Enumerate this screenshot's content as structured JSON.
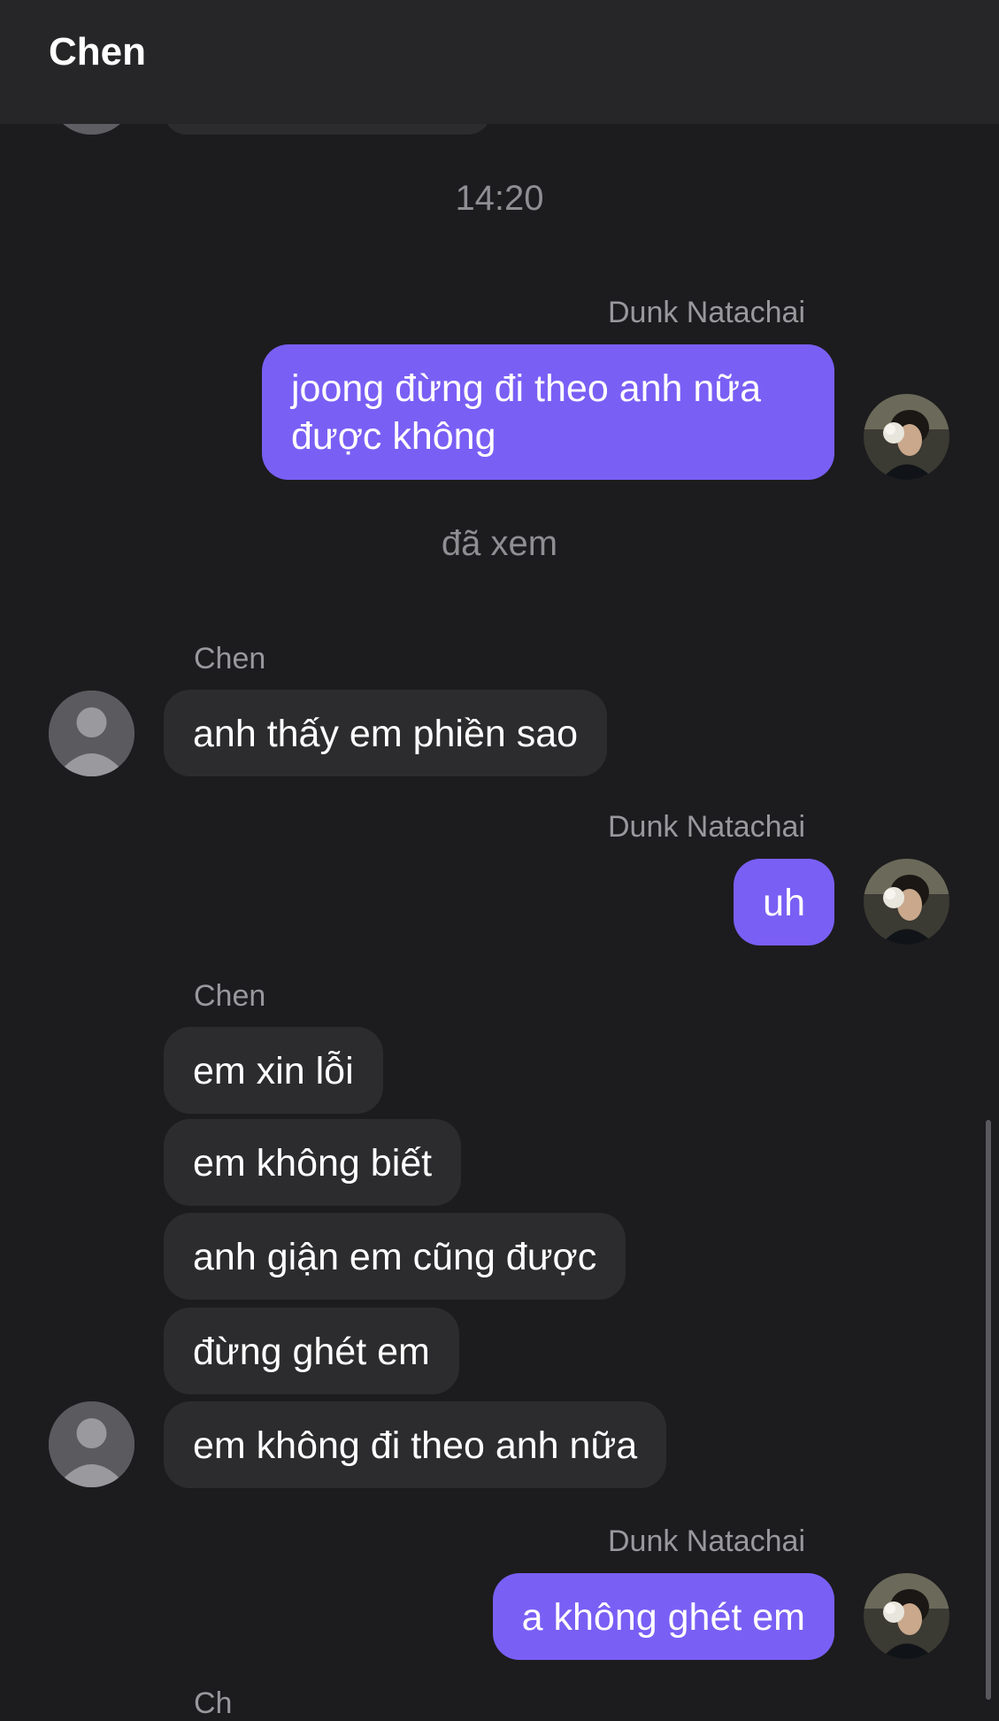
{
  "header": {
    "title": "Chen"
  },
  "thread": {
    "timestamp": "14:20",
    "seen_label": "đã xem",
    "me_name": "Dunk Natachai",
    "them_name": "Chen",
    "messages": [
      {
        "from": "me",
        "text": "joong đừng đi theo anh nữa\nđược không"
      },
      {
        "from": "them",
        "text": "anh thấy em phiền sao"
      },
      {
        "from": "me",
        "text": "uh"
      },
      {
        "from": "them",
        "text": "em xin lỗi"
      },
      {
        "from": "them",
        "text": "em không biết"
      },
      {
        "from": "them",
        "text": "anh giận em cũng được"
      },
      {
        "from": "them",
        "text": "đừng ghét em"
      },
      {
        "from": "them",
        "text": "em không đi theo anh nữa"
      },
      {
        "from": "me",
        "text": "a không ghét em"
      }
    ],
    "next_sender_peek": "Ch"
  },
  "colors": {
    "background": "#1c1c1e",
    "header": "#262628",
    "outgoing_bubble": "#7a5ff5",
    "incoming_bubble": "#2c2c2e",
    "meta_text": "#8e8e93"
  }
}
